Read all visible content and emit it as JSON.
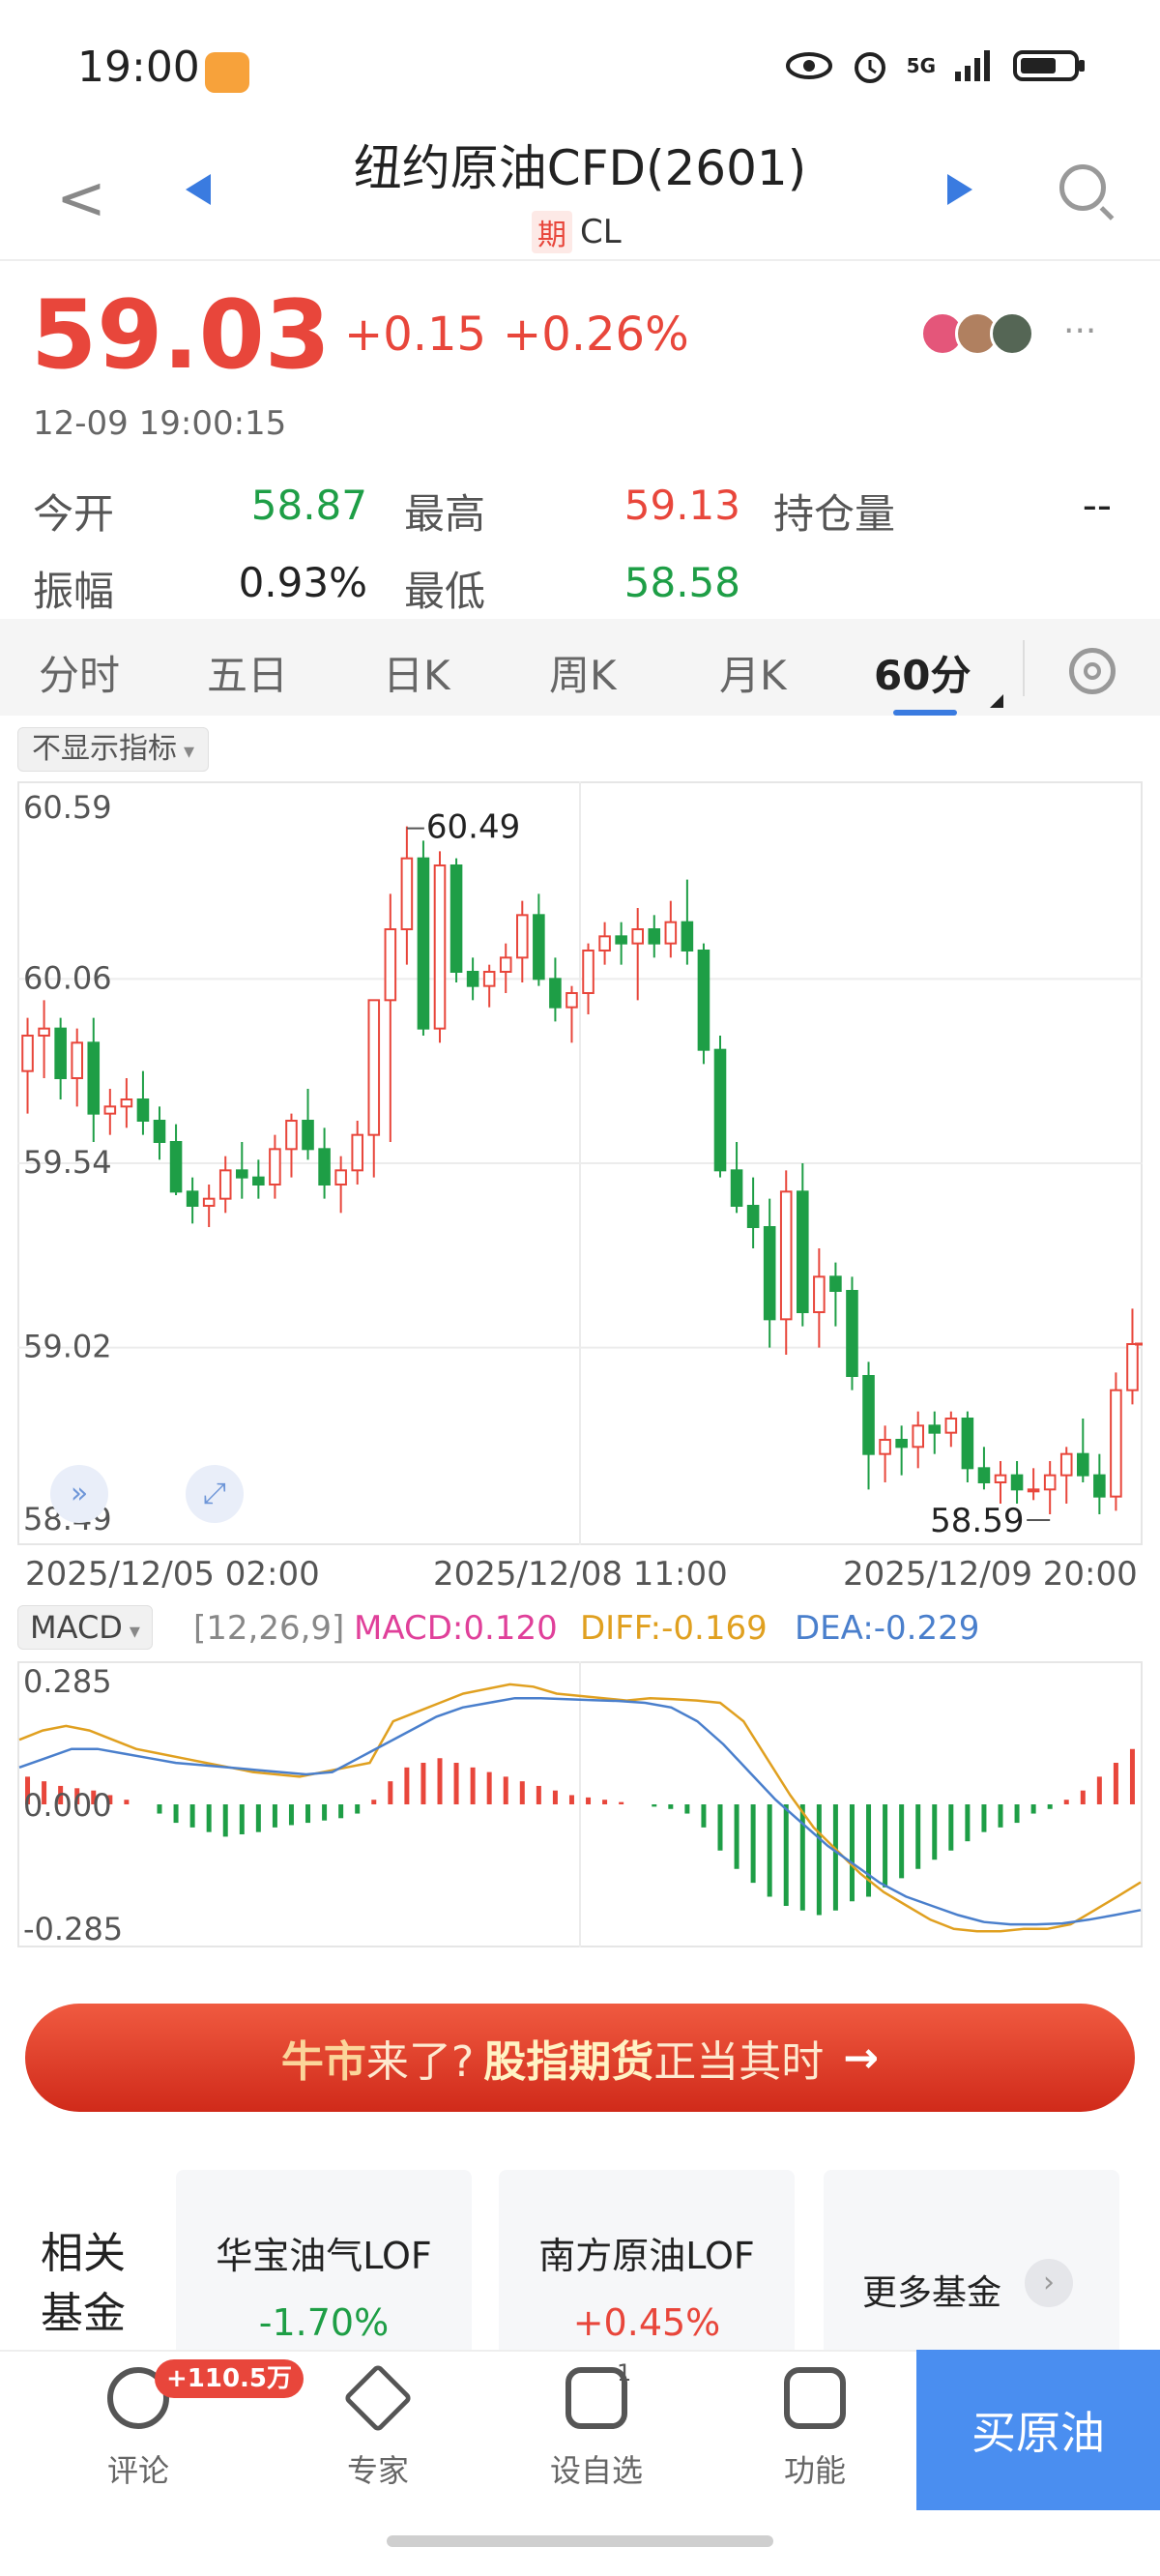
{
  "status": {
    "time": "19:00",
    "signal": "5G"
  },
  "nav": {
    "title": "纽约原油CFD(2601)",
    "badge": "期",
    "code": "CL"
  },
  "quote": {
    "price": "59.03",
    "change": "+0.15",
    "change_pct": "+0.26%",
    "timestamp": "12-09 19:00:15",
    "more": "···"
  },
  "stats": [
    {
      "label": "今开",
      "value": "58.87",
      "color": "green"
    },
    {
      "label": "最高",
      "value": "59.13",
      "color": "red"
    },
    {
      "label": "持仓量",
      "value": "--",
      "color": "black"
    },
    {
      "label": "振幅",
      "value": "0.93%",
      "color": "black"
    },
    {
      "label": "最低",
      "value": "58.58",
      "color": "green"
    }
  ],
  "tabs": [
    "分时",
    "五日",
    "日K",
    "周K",
    "月K",
    "60分"
  ],
  "active_tab": "60分",
  "indicator_select": "不显示指标",
  "chart_data": [
    {
      "type": "candlestick",
      "y_ticks": [
        "60.59",
        "60.06",
        "59.54",
        "59.02",
        "58.49"
      ],
      "ylim": [
        58.49,
        60.59
      ],
      "x_tick_labels": [
        "2025/12/05 02:00",
        "2025/12/08 11:00",
        "2025/12/09 20:00"
      ],
      "annotations": {
        "max": "60.49",
        "min": "58.59"
      },
      "ohlc": [
        [
          59.8,
          59.95,
          59.68,
          59.9
        ],
        [
          59.9,
          60.0,
          59.78,
          59.92
        ],
        [
          59.92,
          59.95,
          59.72,
          59.78
        ],
        [
          59.78,
          59.92,
          59.7,
          59.88
        ],
        [
          59.88,
          59.95,
          59.6,
          59.68
        ],
        [
          59.68,
          59.75,
          59.62,
          59.7
        ],
        [
          59.7,
          59.78,
          59.64,
          59.72
        ],
        [
          59.72,
          59.8,
          59.62,
          59.66
        ],
        [
          59.66,
          59.7,
          59.55,
          59.6
        ],
        [
          59.6,
          59.65,
          59.45,
          59.46
        ],
        [
          59.46,
          59.5,
          59.37,
          59.42
        ],
        [
          59.42,
          59.48,
          59.36,
          59.44
        ],
        [
          59.44,
          59.56,
          59.4,
          59.52
        ],
        [
          59.52,
          59.6,
          59.44,
          59.5
        ],
        [
          59.5,
          59.55,
          59.44,
          59.48
        ],
        [
          59.48,
          59.62,
          59.44,
          59.58
        ],
        [
          59.58,
          59.68,
          59.5,
          59.66
        ],
        [
          59.66,
          59.75,
          59.55,
          59.58
        ],
        [
          59.58,
          59.64,
          59.44,
          59.48
        ],
        [
          59.48,
          59.56,
          59.4,
          59.52
        ],
        [
          59.52,
          59.66,
          59.48,
          59.62
        ],
        [
          59.62,
          59.8,
          59.5,
          60.0
        ],
        [
          60.0,
          60.3,
          59.6,
          60.2
        ],
        [
          60.2,
          60.49,
          60.1,
          60.4
        ],
        [
          60.4,
          60.45,
          59.9,
          59.92
        ],
        [
          59.92,
          60.42,
          59.88,
          60.38
        ],
        [
          60.38,
          60.4,
          60.05,
          60.08
        ],
        [
          60.08,
          60.12,
          60.0,
          60.04
        ],
        [
          60.04,
          60.1,
          59.98,
          60.08
        ],
        [
          60.08,
          60.16,
          60.02,
          60.12
        ],
        [
          60.12,
          60.28,
          60.05,
          60.24
        ],
        [
          60.24,
          60.3,
          60.04,
          60.06
        ],
        [
          60.06,
          60.12,
          59.94,
          59.98
        ],
        [
          59.98,
          60.04,
          59.88,
          60.02
        ],
        [
          60.02,
          60.16,
          59.96,
          60.14
        ],
        [
          60.14,
          60.22,
          60.1,
          60.18
        ],
        [
          60.18,
          60.22,
          60.1,
          60.16
        ],
        [
          60.16,
          60.26,
          60.0,
          60.2
        ],
        [
          60.2,
          60.24,
          60.12,
          60.16
        ],
        [
          60.16,
          60.28,
          60.12,
          60.22
        ],
        [
          60.22,
          60.34,
          60.1,
          60.14
        ],
        [
          60.14,
          60.16,
          59.82,
          59.86
        ],
        [
          59.86,
          59.9,
          59.5,
          59.52
        ],
        [
          59.52,
          59.6,
          59.4,
          59.42
        ],
        [
          59.42,
          59.5,
          59.3,
          59.36
        ],
        [
          59.36,
          59.44,
          59.02,
          59.1
        ],
        [
          59.1,
          59.52,
          59.0,
          59.46
        ],
        [
          59.46,
          59.54,
          59.08,
          59.12
        ],
        [
          59.12,
          59.3,
          59.02,
          59.22
        ],
        [
          59.22,
          59.26,
          59.08,
          59.18
        ],
        [
          59.18,
          59.22,
          58.9,
          58.94
        ],
        [
          58.94,
          58.98,
          58.62,
          58.72
        ],
        [
          58.72,
          58.8,
          58.64,
          58.76
        ],
        [
          58.76,
          58.8,
          58.66,
          58.74
        ],
        [
          58.74,
          58.84,
          58.68,
          58.8
        ],
        [
          58.8,
          58.84,
          58.72,
          58.78
        ],
        [
          58.78,
          58.84,
          58.74,
          58.82
        ],
        [
          58.82,
          58.84,
          58.64,
          58.68
        ],
        [
          58.68,
          58.74,
          58.62,
          58.64
        ],
        [
          58.64,
          58.7,
          58.58,
          58.66
        ],
        [
          58.66,
          58.7,
          58.58,
          58.62
        ],
        [
          58.62,
          58.68,
          58.59,
          58.62
        ],
        [
          58.62,
          58.7,
          58.55,
          58.66
        ],
        [
          58.66,
          58.74,
          58.58,
          58.72
        ],
        [
          58.72,
          58.82,
          58.64,
          58.66
        ],
        [
          58.66,
          58.72,
          58.55,
          58.6
        ],
        [
          58.6,
          58.95,
          58.56,
          58.9
        ],
        [
          58.9,
          59.13,
          58.86,
          59.03
        ]
      ]
    },
    {
      "type": "macd",
      "params": "[12,26,9]",
      "selector": "MACD",
      "labels": {
        "macd": "MACD:0.120",
        "diff": "DIFF:-0.169",
        "dea": "DEA:-0.229"
      },
      "colors": {
        "macd": "#e0409a",
        "diff": "#e0a020",
        "dea": "#4a7fcc",
        "up": "#e8463b",
        "down": "#1e9e46"
      },
      "y_ticks": [
        "0.285",
        "0.000",
        "-0.285"
      ],
      "ylim": [
        -0.285,
        0.285
      ],
      "bars": [
        0.06,
        0.05,
        0.04,
        0.035,
        0.03,
        0.02,
        0.01,
        0.0,
        -0.02,
        -0.04,
        -0.05,
        -0.06,
        -0.07,
        -0.065,
        -0.06,
        -0.05,
        -0.045,
        -0.04,
        -0.035,
        -0.03,
        -0.02,
        0.01,
        0.05,
        0.08,
        0.09,
        0.1,
        0.09,
        0.08,
        0.07,
        0.06,
        0.05,
        0.04,
        0.03,
        0.02,
        0.015,
        0.01,
        0.005,
        0.0,
        -0.005,
        -0.01,
        -0.02,
        -0.05,
        -0.1,
        -0.14,
        -0.17,
        -0.2,
        -0.22,
        -0.23,
        -0.24,
        -0.23,
        -0.21,
        -0.2,
        -0.18,
        -0.16,
        -0.14,
        -0.12,
        -0.1,
        -0.08,
        -0.06,
        -0.05,
        -0.04,
        -0.02,
        -0.01,
        0.01,
        0.03,
        0.06,
        0.09,
        0.12
      ],
      "diff": [
        0.14,
        0.16,
        0.17,
        0.16,
        0.14,
        0.12,
        0.11,
        0.1,
        0.09,
        0.08,
        0.07,
        0.065,
        0.06,
        0.07,
        0.08,
        0.09,
        0.18,
        0.2,
        0.22,
        0.24,
        0.25,
        0.26,
        0.255,
        0.24,
        0.235,
        0.23,
        0.225,
        0.23,
        0.228,
        0.225,
        0.22,
        0.18,
        0.1,
        0.02,
        -0.05,
        -0.1,
        -0.15,
        -0.19,
        -0.22,
        -0.25,
        -0.27,
        -0.275,
        -0.275,
        -0.27,
        -0.27,
        -0.26,
        -0.23,
        -0.2,
        -0.169
      ],
      "dea": [
        0.08,
        0.1,
        0.12,
        0.12,
        0.11,
        0.1,
        0.09,
        0.085,
        0.08,
        0.075,
        0.07,
        0.065,
        0.07,
        0.1,
        0.13,
        0.16,
        0.19,
        0.21,
        0.22,
        0.23,
        0.23,
        0.228,
        0.226,
        0.224,
        0.22,
        0.21,
        0.18,
        0.13,
        0.07,
        0.01,
        -0.04,
        -0.09,
        -0.13,
        -0.17,
        -0.2,
        -0.22,
        -0.24,
        -0.255,
        -0.26,
        -0.26,
        -0.258,
        -0.25,
        -0.24,
        -0.229
      ]
    }
  ],
  "banner": {
    "part1": "牛市",
    "part2": "来了?",
    "part3": "股指期货",
    "part4": "正当其时",
    "arrow": "→"
  },
  "funds": {
    "title": "相关基金",
    "items": [
      {
        "name": "华宝油气LOF",
        "value": "-1.70%",
        "color": "green"
      },
      {
        "name": "南方原油LOF",
        "value": "+0.45%",
        "color": "red"
      }
    ],
    "more": "更多基金"
  },
  "bottom": {
    "items": [
      {
        "label": "评论",
        "badge": "+110.5万"
      },
      {
        "label": "专家"
      },
      {
        "label": "设自选",
        "count": "1"
      },
      {
        "label": "功能"
      }
    ],
    "buy": "买原油"
  }
}
